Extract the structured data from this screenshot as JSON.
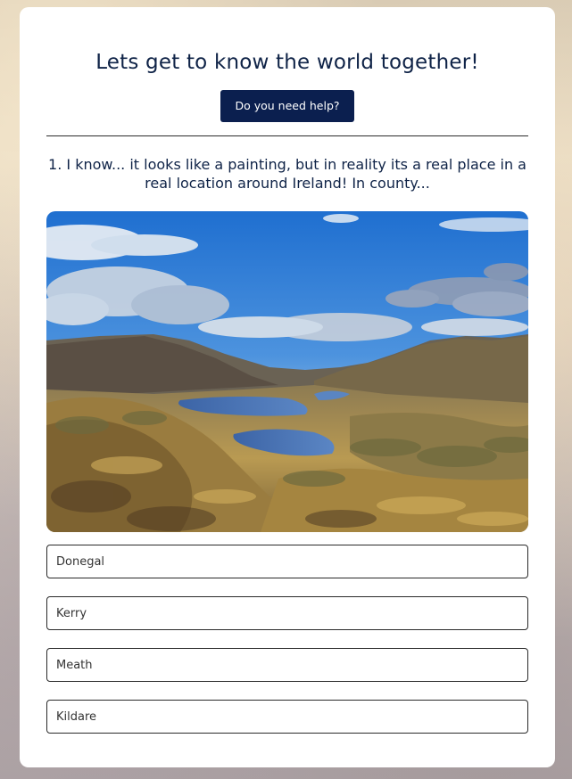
{
  "quiz": {
    "title": "Lets get to know the world together!",
    "help_label": "Do you need help?",
    "question": "1. I know... it looks like a painting, but in reality its a real place in a real location around Ireland! In county...",
    "answers": [
      {
        "label": "Donegal"
      },
      {
        "label": "Kerry"
      },
      {
        "label": "Meath"
      },
      {
        "label": "Kildare"
      }
    ]
  },
  "colors": {
    "title": "#0f2347",
    "button": "#0b1f4f",
    "card": "#ffffff"
  }
}
